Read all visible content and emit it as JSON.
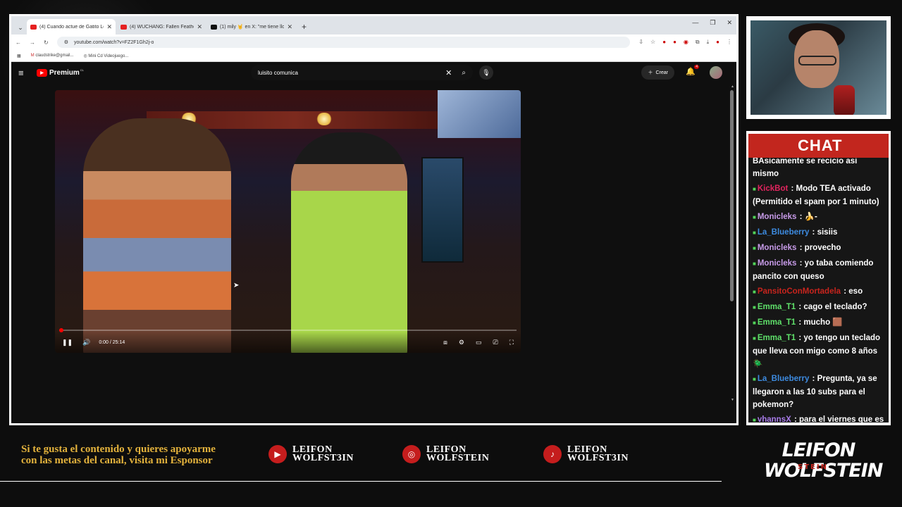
{
  "browser": {
    "tabs": [
      {
        "title": "(4) Cuando actue de Gatito Lo...",
        "icon": "youtube-icon",
        "active": true
      },
      {
        "title": "(4) WUCHANG: Fallen Feathers",
        "icon": "youtube-icon",
        "active": false
      },
      {
        "title": "(1) mily 🤘 en X: \"me tiene lloc...",
        "icon": "x-icon",
        "active": false
      }
    ],
    "url": "youtube.com/watch?v=FZ2F1Gh2j-o",
    "bookmarks": [
      "claudstrike@gmail...",
      "Mini Cd Videojuego..."
    ]
  },
  "youtube": {
    "logo": "Premium",
    "logo_sup": "CL",
    "search_value": "luisito comunica",
    "create_label": "Crear",
    "notif_count": "4"
  },
  "player": {
    "time": "0:00 / 25:14",
    "progress": 0.0
  },
  "chat": {
    "title": "CHAT",
    "messages": [
      {
        "user": "",
        "text": "BAsicamente se recicio asi mismo",
        "color": "#ffffff"
      },
      {
        "user": "KickBot",
        "text": " : Modo TEA activado (Permitido el spam por 1 minuto)",
        "color": "#e0245e"
      },
      {
        "user": "Monicleks",
        "text": " : 🍌-",
        "color": "#c79be8"
      },
      {
        "user": "La_Blueberry",
        "text": " : sisiis",
        "color": "#3d8be0"
      },
      {
        "user": "Monicleks",
        "text": " : provecho",
        "color": "#c79be8"
      },
      {
        "user": "Monicleks",
        "text": " : yo taba comiendo pancito con queso",
        "color": "#c79be8"
      },
      {
        "user": "PansitoConMortadela",
        "text": " : eso",
        "color": "#c7241d"
      },
      {
        "user": "Emma_T1",
        "text": " : cago el teclado?",
        "color": "#5fe06a"
      },
      {
        "user": "Emma_T1",
        "text": " : mucho 🟫",
        "color": "#5fe06a"
      },
      {
        "user": "Emma_T1",
        "text": " : yo tengo un teclado que lleva con migo como 8 años 🪲",
        "color": "#5fe06a"
      },
      {
        "user": "La_Blueberry",
        "text": " : Pregunta, ya se llegaron a las 10 subs para el pokemon?",
        "color": "#3d8be0"
      },
      {
        "user": "vhannsX",
        "text": " : para el viernes que es black friday 🟫",
        "color": "#a77be8"
      }
    ]
  },
  "footer": {
    "promo": "Si te gusta el contenido y quieres apoyarme con las metas del canal, visita mi Esponsor",
    "socials": [
      {
        "icon": "youtube-icon",
        "line1": "LEIFON",
        "line2": "WOLFST3IN"
      },
      {
        "icon": "instagram-icon",
        "line1": "LEIFON",
        "line2": "WOLFSTEIN"
      },
      {
        "icon": "tiktok-icon",
        "line1": "LEIFON",
        "line2": "WOLFST3IN"
      }
    ],
    "brand1": "LEIFON",
    "brand2": "WOLFSTEIN",
    "brand_overlay": "STEIN"
  }
}
